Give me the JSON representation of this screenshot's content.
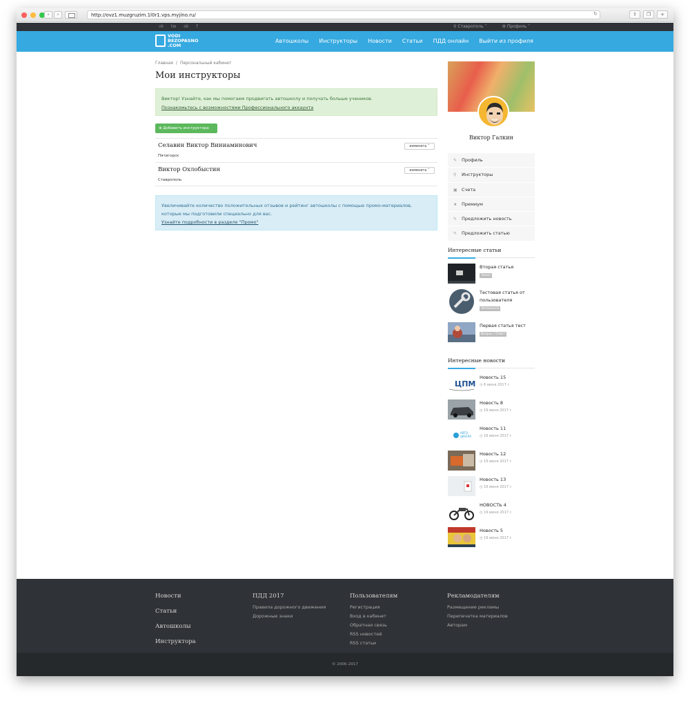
{
  "browser": {
    "url": "http://ovz1.muzgruzim.1l0r1.vps.myjino.ru/"
  },
  "topbar": {
    "social": [
      "vk",
      "tw",
      "ok",
      "f"
    ],
    "city": "Ставрополь",
    "profile": "Профиль"
  },
  "logo": {
    "line1": "VODI",
    "line2": "BEZOPASNO",
    "line3": ".COM"
  },
  "nav": {
    "items": [
      "Автошколы",
      "Инструкторы",
      "Новости",
      "Статьи",
      "ПДД онлайн",
      "Выйти из профиля"
    ]
  },
  "breadcrumb": {
    "home": "Главная",
    "current": "Персональный кабинет"
  },
  "page": {
    "title": "Мои инструкторы"
  },
  "alert_green": {
    "text": "Виктор! Узнайте, как мы помогаем продвигать автошколу и получать больше учеников.",
    "link": "Познакомьтесь с возможностями Профессионального аккаунта"
  },
  "add_button": "Добавить инструктора",
  "instructors": [
    {
      "name": "Селавин Виктор Виниаминович",
      "city": "Пятигорск",
      "edit": "изменить"
    },
    {
      "name": "Виктор Охлобыстин",
      "city": "Ставрополь",
      "edit": "изменить"
    }
  ],
  "alert_blue": {
    "text": "Увеличивайте количество положительных отзывов и рейтинг автошколы с помощью промо-материалов, которые мы подготовили специально для вас.",
    "link": "Узнайте подробности в разделе \"Промо\""
  },
  "profile": {
    "name": "Виктор Галкин",
    "menu": [
      "Профиль",
      "Инструкторы",
      "Счета",
      "Премиум",
      "Предложить новость",
      "Предложить статью"
    ]
  },
  "articles": {
    "title": "Интересные статьи",
    "items": [
      {
        "title": "Вторая статья",
        "tag": "Закон"
      },
      {
        "title": "Тестовая статья от пользователя",
        "tag": "Автошкола"
      },
      {
        "title": "Первая статья тест",
        "tag": "Вопрос / Ответ"
      }
    ]
  },
  "news": {
    "title": "Интересные новости",
    "items": [
      {
        "title": "Новость 15",
        "date": "6 июня 2017 г."
      },
      {
        "title": "Новость 8",
        "date": "19 июня 2017 г."
      },
      {
        "title": "Новость 11",
        "date": "19 июня 2017 г."
      },
      {
        "title": "Новость 12",
        "date": "19 июня 2017 г."
      },
      {
        "title": "Новость 13",
        "date": "19 июня 2017 г."
      },
      {
        "title": "НОВОСТЬ 4",
        "date": "19 июня 2017 г."
      },
      {
        "title": "Новость 5",
        "date": "19 июня 2017 г."
      }
    ]
  },
  "footer": {
    "main_links": [
      "Новости",
      "Статьи",
      "Автошколы",
      "Инструктора"
    ],
    "pdd": {
      "title": "ПДД 2017",
      "links": [
        "Правила дорожного движения",
        "Дорожные знаки"
      ]
    },
    "users": {
      "title": "Пользователям",
      "links": [
        "Регистрация",
        "Вход в кабинет",
        "Обратная связь",
        "RSS новостей",
        "RSS статьи"
      ]
    },
    "advertisers": {
      "title": "Рекламодателям",
      "links": [
        "Размещение рекламы",
        "Перепечатка материалов",
        "Авторам"
      ]
    },
    "copyright": "© 2006–2017"
  }
}
